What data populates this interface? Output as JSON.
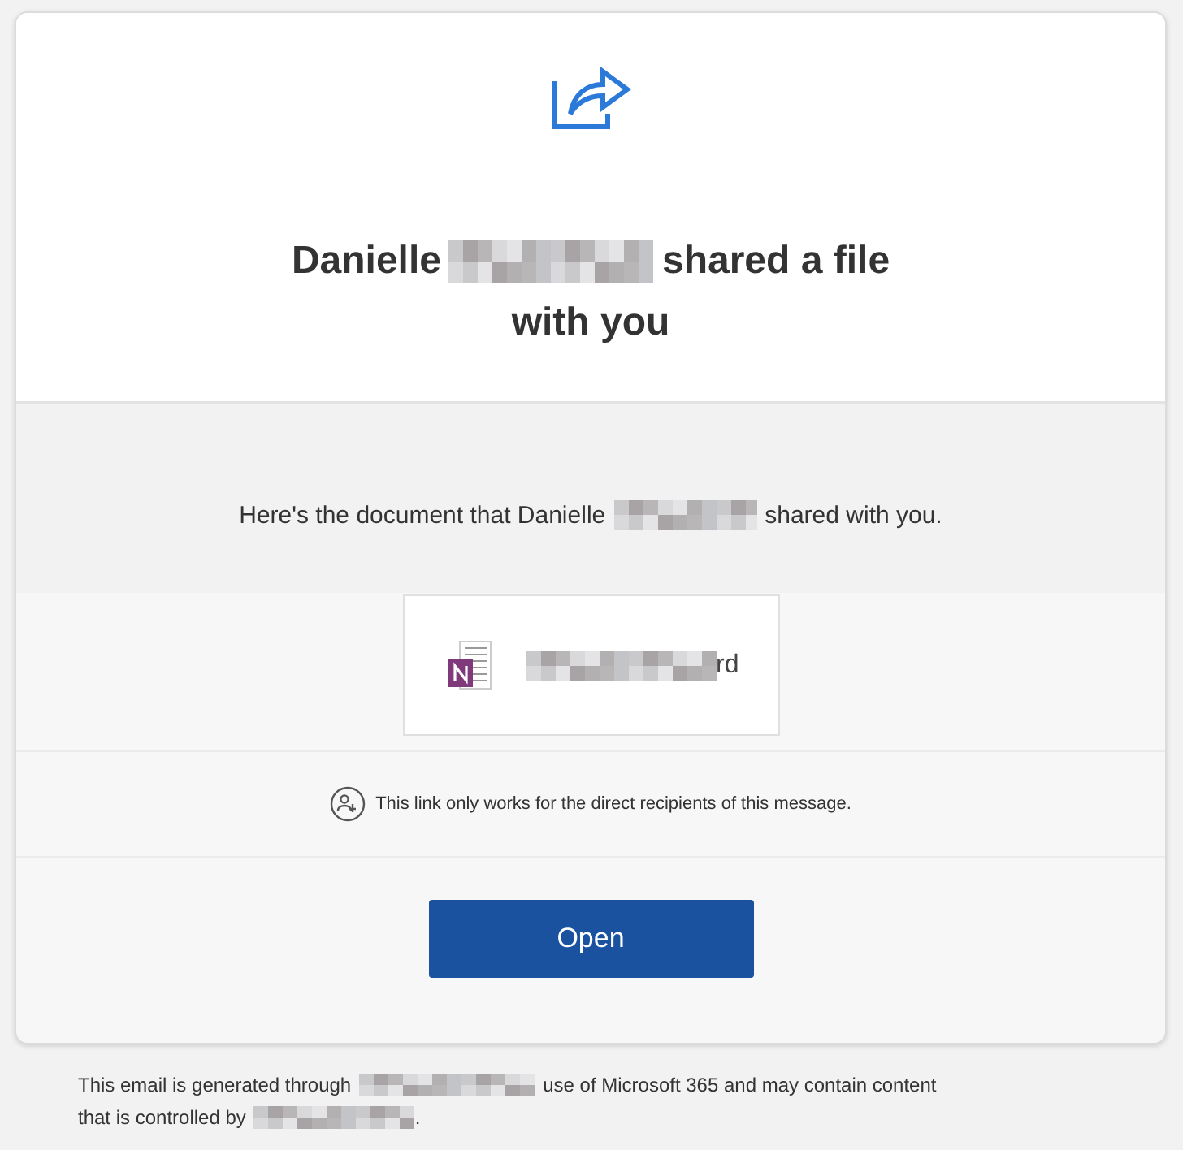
{
  "header": {
    "title_start": "Danielle",
    "title_end": "shared a file",
    "title_line2": "with you"
  },
  "message": {
    "text_start": "Here's the document that Danielle",
    "text_end": "shared with you."
  },
  "file": {
    "name_end": "rd"
  },
  "notice": "This link only works for the direct recipients of this message.",
  "button": {
    "label": "Open"
  },
  "footer": {
    "text_start": "This email is generated through",
    "text_middle": "use of Microsoft 365 and may contain content",
    "text_line2": "that is controlled by",
    "text_end": "."
  }
}
